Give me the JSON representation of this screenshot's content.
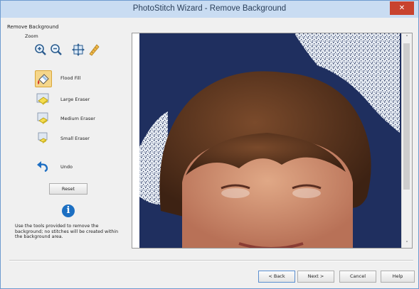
{
  "window": {
    "title": "PhotoStitch Wizard - Remove Background",
    "close_glyph": "✕"
  },
  "panel": {
    "group_label": "Remove Background",
    "zoom_label": "Zoom",
    "zoom_tools": [
      {
        "name": "zoom-in-icon"
      },
      {
        "name": "zoom-out-icon"
      },
      {
        "name": "zoom-fit-icon"
      },
      {
        "name": "ruler-icon"
      }
    ],
    "tools": {
      "flood_fill": "Flood Fill",
      "large_eraser": "Large Eraser",
      "medium_eraser": "Medium Eraser",
      "small_eraser": "Small Eraser",
      "undo": "Undo"
    },
    "reset_label": "Reset",
    "info_glyph": "i",
    "help_text": "Use the tools provided to remove the background; no stitches will be created within the background area."
  },
  "scroll": {
    "up": "˄",
    "down": "˅"
  },
  "footer": {
    "back": "< Back",
    "next": "Next >",
    "cancel": "Cancel",
    "help": "Help"
  },
  "colors": {
    "accent": "#1c6fc2",
    "title_bg": "#c9dcf2",
    "photo_bg": "#1f2f5f",
    "active_tool": "#f5d68a"
  }
}
